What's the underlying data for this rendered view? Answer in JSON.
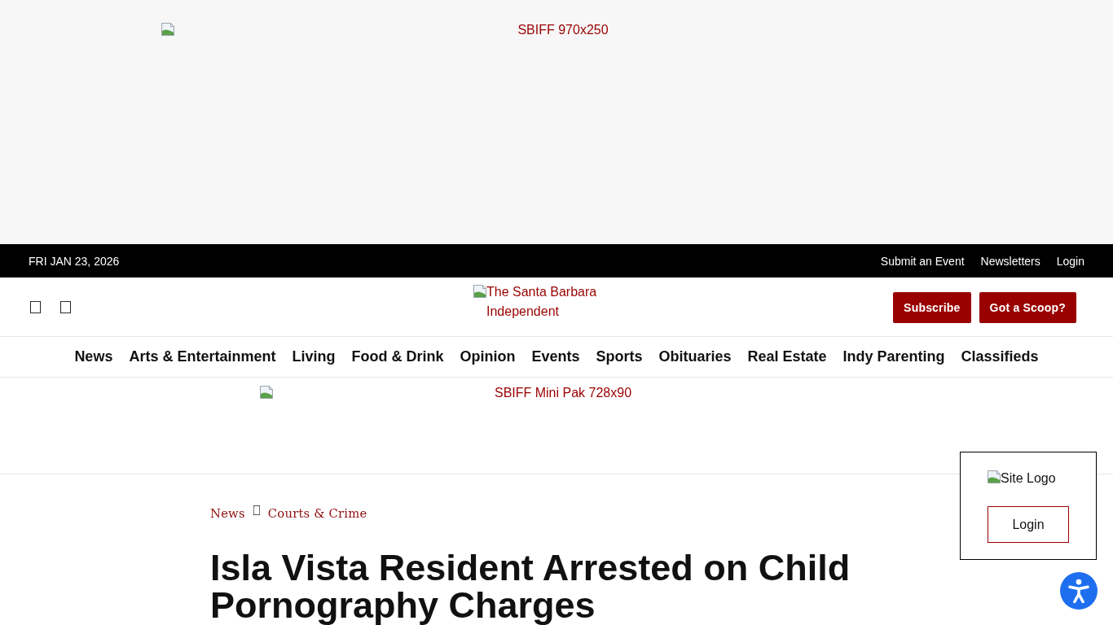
{
  "top_ad": {
    "alt_text": "SBIFF 970x250"
  },
  "top_bar": {
    "date": "FRI JAN 23, 2026",
    "links": [
      "Submit an Event",
      "Newsletters",
      "Login"
    ]
  },
  "header": {
    "logo_alt": "The Santa Barbara Independent",
    "buttons": [
      "Subscribe",
      "Got a Scoop?"
    ]
  },
  "nav": {
    "items": [
      "News",
      "Arts & Entertainment",
      "Living",
      "Food & Drink",
      "Opinion",
      "Events",
      "Sports",
      "Obituaries",
      "Real Estate",
      "Indy Parenting",
      "Classifieds"
    ]
  },
  "leaderboard_ad": {
    "alt_text": "SBIFF Mini Pak 728x90"
  },
  "article": {
    "breadcrumb": [
      "News",
      "Courts & Crime"
    ],
    "title": "Isla Vista Resident Arrested on Child Pornography Charges"
  },
  "login_popup": {
    "logo_alt": "Site Logo",
    "button": "Login"
  }
}
